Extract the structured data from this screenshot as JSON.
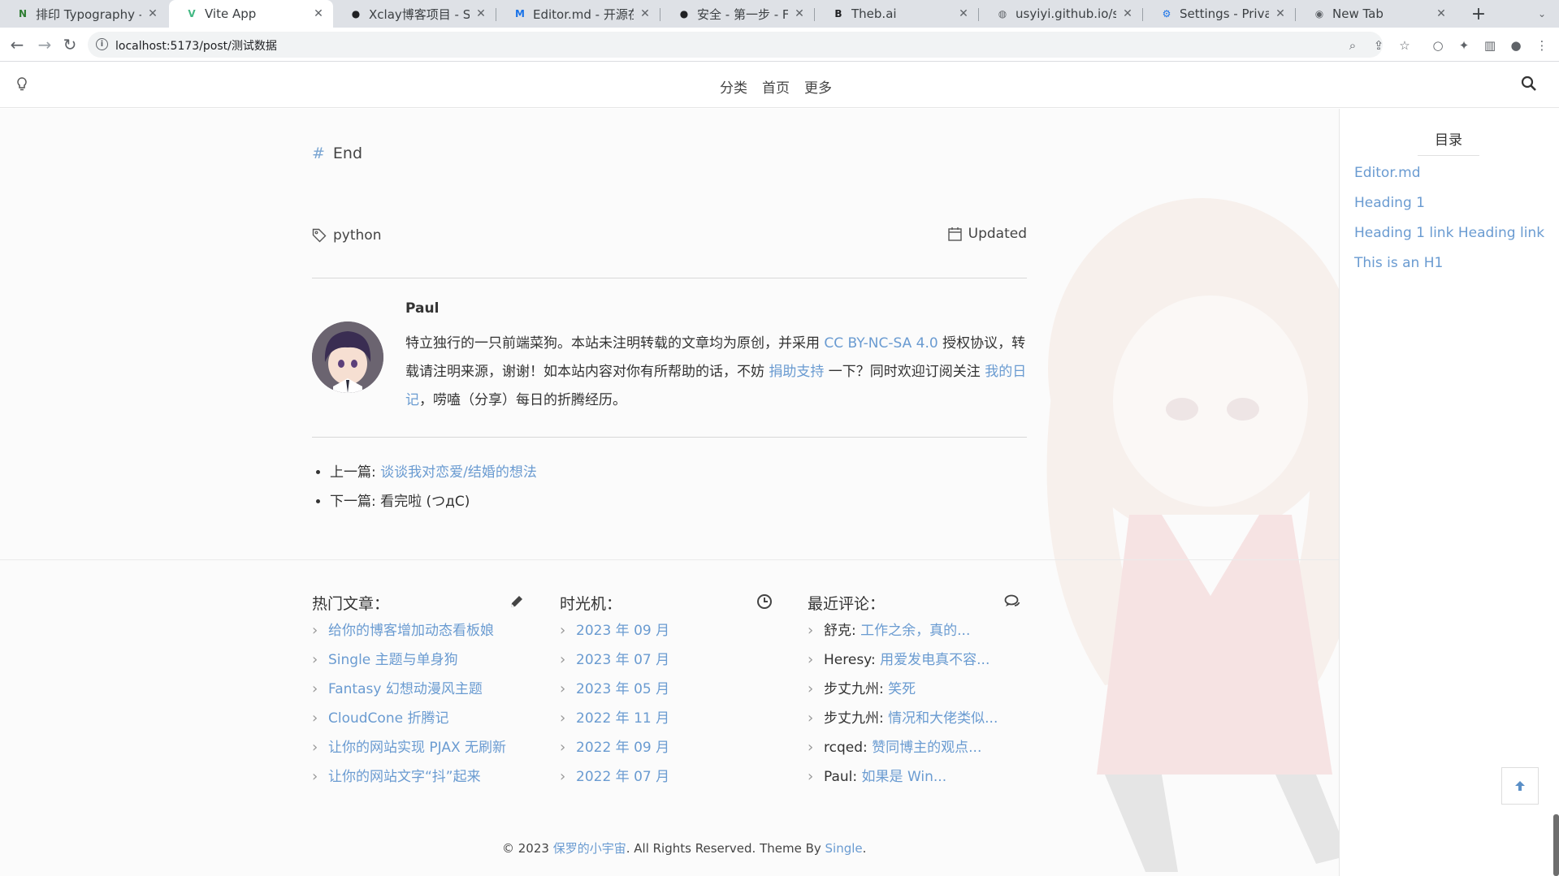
{
  "browser": {
    "tabs": [
      {
        "title": "排印 Typography - N",
        "icon": "notion-n-icon",
        "color": "#2e7d32",
        "glyph": "N"
      },
      {
        "title": "Vite App",
        "icon": "vue-icon",
        "color": "#42b883",
        "glyph": "V"
      },
      {
        "title": "Xclay博客项目 - Sw",
        "icon": "github-icon",
        "color": "#202124",
        "glyph": "●"
      },
      {
        "title": "Editor.md - 开源在线",
        "icon": "editormd-icon",
        "color": "#1a73e8",
        "glyph": "M"
      },
      {
        "title": "安全 - 第一步 - Fast",
        "icon": "github-icon",
        "color": "#202124",
        "glyph": "●"
      },
      {
        "title": "Theb.ai",
        "icon": "thebai-icon",
        "color": "#202124",
        "glyph": "B"
      },
      {
        "title": "usyiyi.github.io/sql",
        "icon": "globe-icon",
        "color": "#5f6368",
        "glyph": "◍"
      },
      {
        "title": "Settings - Privacy ar",
        "icon": "settings-gear-icon",
        "color": "#1a73e8",
        "glyph": "⚙"
      },
      {
        "title": "New Tab",
        "icon": "chrome-icon",
        "color": "#5f6368",
        "glyph": "◉"
      }
    ],
    "active_tab": 1,
    "url": "localhost:5173/post/测试数据"
  },
  "site": {
    "nav": [
      "分类",
      "首页",
      "更多"
    ]
  },
  "article": {
    "heading_hash": "#",
    "heading": "End",
    "tag": "python",
    "updated_label": "Updated",
    "author": {
      "name": "Paul",
      "bio_1": "特立独行的一只前端菜狗。本站未注明转载的文章均为原创，并采用 ",
      "bio_license": "CC BY-NC-SA 4.0",
      "bio_2": " 授权协议，转载请注明来源，谢谢！如本站内容对你有所帮助的话，不妨 ",
      "bio_donate": "捐助支持",
      "bio_3": " 一下？同时欢迎订阅关注 ",
      "bio_diary": "我的日记",
      "bio_4": "，唠嗑（分享）每日的折腾经历。"
    },
    "prev_label": "上一篇: ",
    "prev_title": "谈谈我对恋爱/结婚的想法",
    "next_label": "下一篇: ",
    "next_title": "看完啦 (つдC)"
  },
  "widgets": {
    "popular": {
      "title": "热门文章：",
      "items": [
        "给你的博客增加动态看板娘",
        "Single 主题与单身狗",
        "Fantasy 幻想动漫风主题",
        "CloudCone 折腾记",
        "让你的网站实现 PJAX 无刷新",
        "让你的网站文字“抖”起来"
      ]
    },
    "archive": {
      "title": "时光机：",
      "items": [
        "2023 年 09 月",
        "2023 年 07 月",
        "2023 年 05 月",
        "2022 年 11 月",
        "2022 年 09 月",
        "2022 年 07 月"
      ]
    },
    "comments": {
      "title": "最近评论：",
      "items": [
        {
          "user": "舒克: ",
          "text": "工作之余，真的..."
        },
        {
          "user": "Heresy: ",
          "text": "用爱发电真不容..."
        },
        {
          "user": "步丈九州: ",
          "text": "笑死"
        },
        {
          "user": "步丈九州: ",
          "text": "情况和大佬类似..."
        },
        {
          "user": "rcqed: ",
          "text": "赞同博主的观点..."
        },
        {
          "user": "Paul: ",
          "text": "如果是 Win..."
        }
      ]
    }
  },
  "footer": {
    "prefix": "© 2023 ",
    "site_name": "保罗的小宇宙",
    "middle": ". All Rights Reserved. Theme By ",
    "theme": "Single",
    "suffix": "."
  },
  "toc": {
    "title": "目录",
    "items": [
      "Editor.md",
      "Heading 1",
      "Heading 1 link Heading link",
      "This is an H1"
    ]
  },
  "colors": {
    "link": "#6a9bd1",
    "tabbar": "#dee1e6"
  }
}
